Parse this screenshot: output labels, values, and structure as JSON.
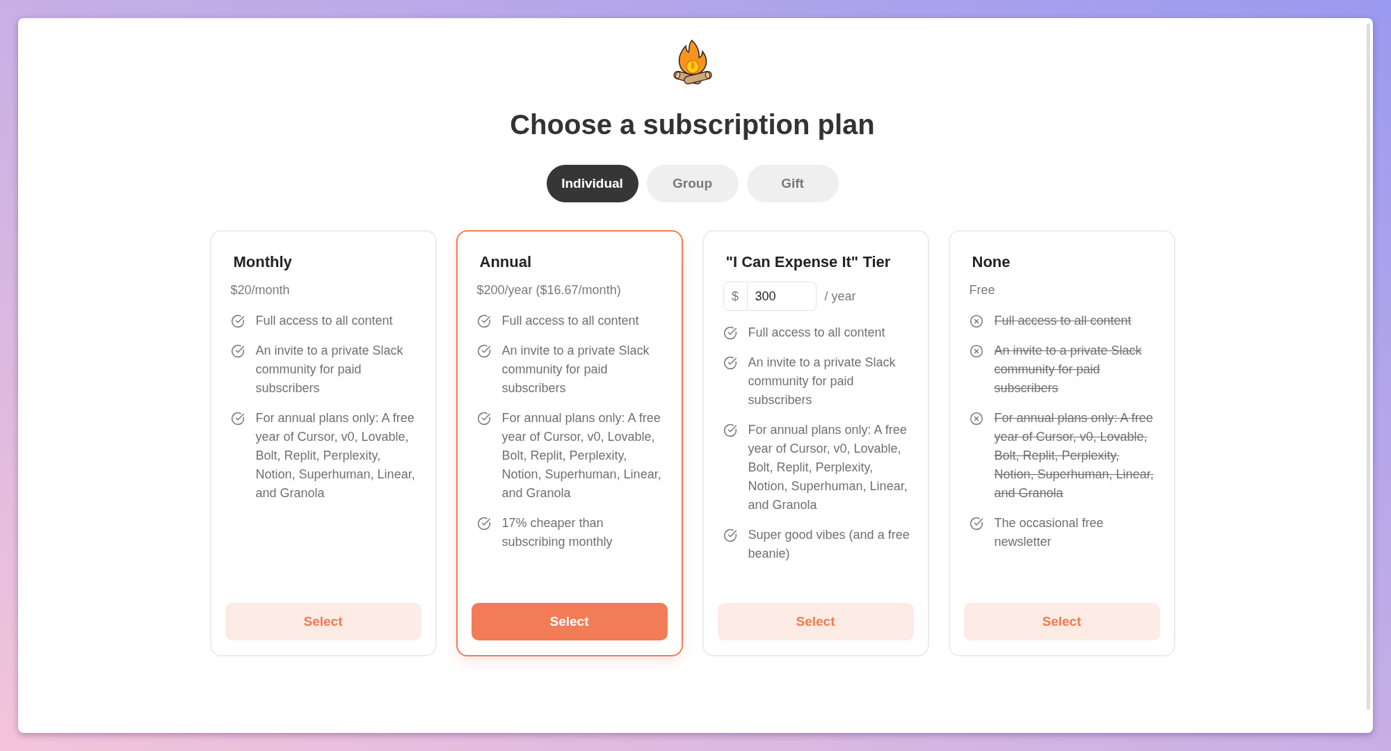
{
  "title": "Choose a subscription plan",
  "tabs": [
    {
      "label": "Individual",
      "selected": true
    },
    {
      "label": "Group",
      "selected": false
    },
    {
      "label": "Gift",
      "selected": false
    }
  ],
  "plans": [
    {
      "name": "Monthly",
      "selected": false,
      "price": {
        "kind": "text",
        "text": "$20/month"
      },
      "features": [
        {
          "text": "Full access to all content",
          "included": true
        },
        {
          "text": "An invite to a private Slack community for paid subscribers",
          "included": true
        },
        {
          "text": "For annual plans only: A free year of Cursor, v0, Lovable, Bolt, Replit, Perplexity, Notion, Superhuman, Linear, and Granola",
          "included": true
        }
      ],
      "button": "Select"
    },
    {
      "name": "Annual",
      "selected": true,
      "price": {
        "kind": "text",
        "text": "$200/year ($16.67/month)"
      },
      "features": [
        {
          "text": "Full access to all content",
          "included": true
        },
        {
          "text": "An invite to a private Slack community for paid subscribers",
          "included": true
        },
        {
          "text": "For annual plans only: A free year of Cursor, v0, Lovable, Bolt, Replit, Perplexity, Notion, Superhuman, Linear, and Granola",
          "included": true
        },
        {
          "text": "17% cheaper than subscribing monthly",
          "included": true
        }
      ],
      "button": "Select"
    },
    {
      "name": "\"I Can Expense It\" Tier",
      "selected": false,
      "price": {
        "kind": "input",
        "prefix": "$",
        "value": "300",
        "suffix": "/ year"
      },
      "features": [
        {
          "text": "Full access to all content",
          "included": true
        },
        {
          "text": "An invite to a private Slack community for paid subscribers",
          "included": true
        },
        {
          "text": "For annual plans only: A free year of Cursor, v0, Lovable, Bolt, Replit, Perplexity, Notion, Superhuman, Linear, and Granola",
          "included": true
        },
        {
          "text": "Super good vibes (and a free beanie)",
          "included": true
        }
      ],
      "button": "Select"
    },
    {
      "name": "None",
      "selected": false,
      "price": {
        "kind": "text",
        "text": "Free"
      },
      "features": [
        {
          "text": "Full access to all content",
          "included": false
        },
        {
          "text": "An invite to a private Slack community for paid subscribers",
          "included": false
        },
        {
          "text": "For annual plans only: A free year of Cursor, v0, Lovable, Bolt, Replit, Perplexity, Notion, Superhuman, Linear, and Granola",
          "included": false
        },
        {
          "text": "The occasional free newsletter",
          "included": true
        }
      ],
      "button": "Select"
    }
  ]
}
